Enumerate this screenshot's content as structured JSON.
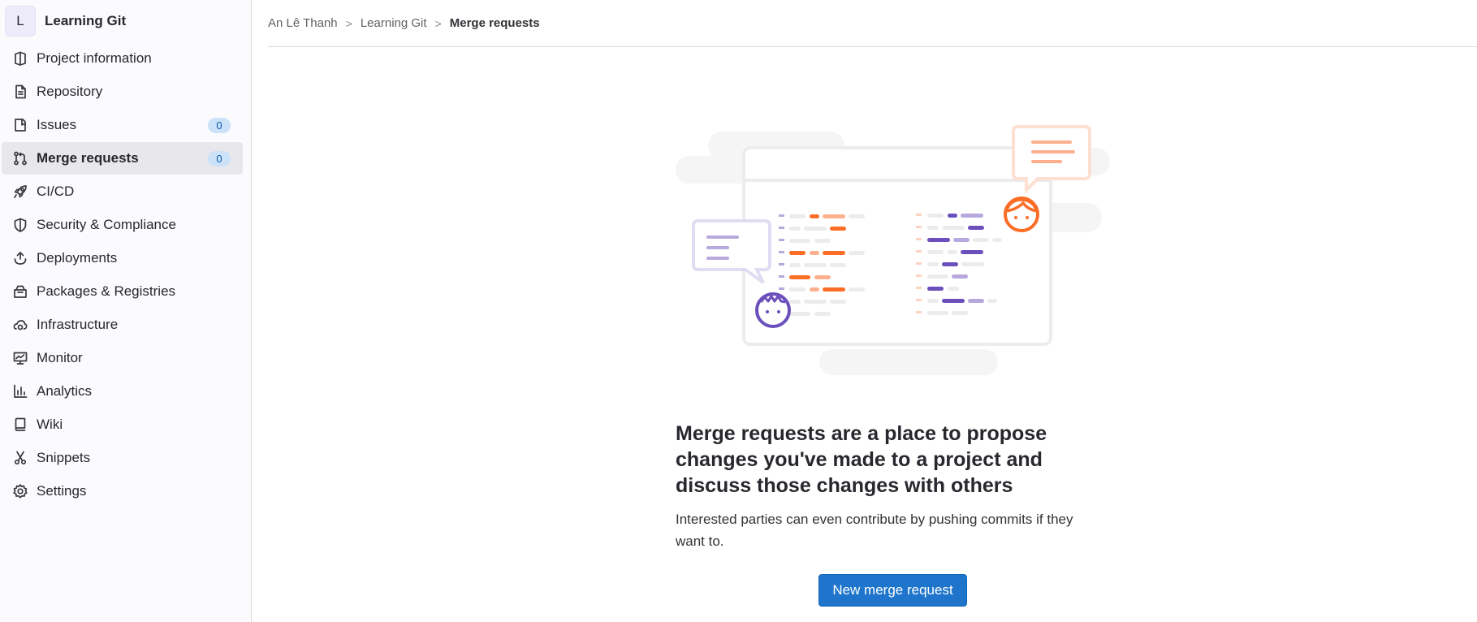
{
  "project": {
    "avatar_letter": "L",
    "name": "Learning Git"
  },
  "sidebar": {
    "items": [
      {
        "label": "Project information",
        "icon": "project-info-icon"
      },
      {
        "label": "Repository",
        "icon": "document-icon"
      },
      {
        "label": "Issues",
        "icon": "issues-icon",
        "badge": "0"
      },
      {
        "label": "Merge requests",
        "icon": "merge-request-icon",
        "badge": "0",
        "active": true
      },
      {
        "label": "CI/CD",
        "icon": "rocket-icon"
      },
      {
        "label": "Security & Compliance",
        "icon": "shield-icon"
      },
      {
        "label": "Deployments",
        "icon": "deployments-icon"
      },
      {
        "label": "Packages & Registries",
        "icon": "package-icon"
      },
      {
        "label": "Infrastructure",
        "icon": "cloud-gear-icon"
      },
      {
        "label": "Monitor",
        "icon": "monitor-icon"
      },
      {
        "label": "Analytics",
        "icon": "chart-icon"
      },
      {
        "label": "Wiki",
        "icon": "book-icon"
      },
      {
        "label": "Snippets",
        "icon": "scissors-icon"
      },
      {
        "label": "Settings",
        "icon": "gear-icon"
      }
    ]
  },
  "breadcrumb": {
    "items": [
      "An Lê Thanh",
      "Learning Git",
      "Merge requests"
    ],
    "separator": ">"
  },
  "empty_state": {
    "title": "Merge requests are a place to propose changes you've made to a project and discuss those changes with others",
    "description": "Interested parties can even contribute by pushing commits if they want to.",
    "button_label": "New merge request"
  },
  "colors": {
    "accent": "#1f75cb",
    "badge_bg": "#cbe2f9",
    "orange": "#fc6d26",
    "purple": "#6b4fbb"
  }
}
